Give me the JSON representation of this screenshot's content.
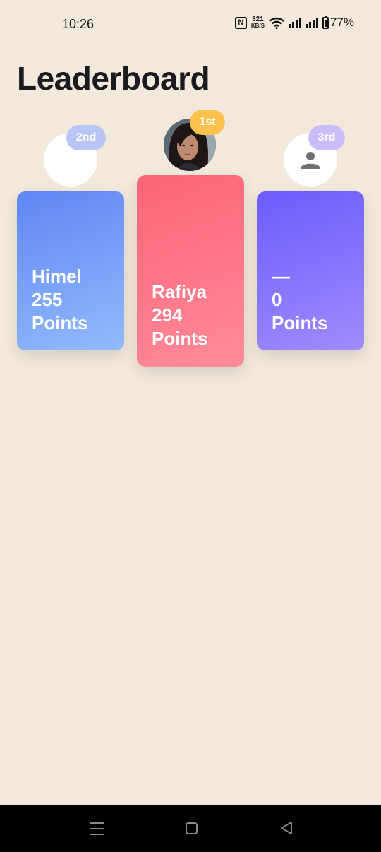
{
  "status_bar": {
    "time": "10:26",
    "nfc": "N",
    "speed_value": "321",
    "speed_unit": "KB/S",
    "battery": "77%"
  },
  "page": {
    "title": "Leaderboard"
  },
  "podium": {
    "second": {
      "rank": "2nd",
      "name": "Himel",
      "score": "255",
      "unit": "Points",
      "avatar": "blank",
      "color": "#5f86f4"
    },
    "first": {
      "rank": "1st",
      "name": "Rafiya",
      "score": "294",
      "unit": "Points",
      "avatar": "photo",
      "color": "#fe6378"
    },
    "third": {
      "rank": "3rd",
      "name": "—",
      "score": "0",
      "unit": "Points",
      "avatar": "person-icon",
      "color": "#6b5cfd"
    }
  },
  "nav_bar": {
    "icons": [
      "menu-icon",
      "home-icon",
      "back-icon"
    ]
  }
}
